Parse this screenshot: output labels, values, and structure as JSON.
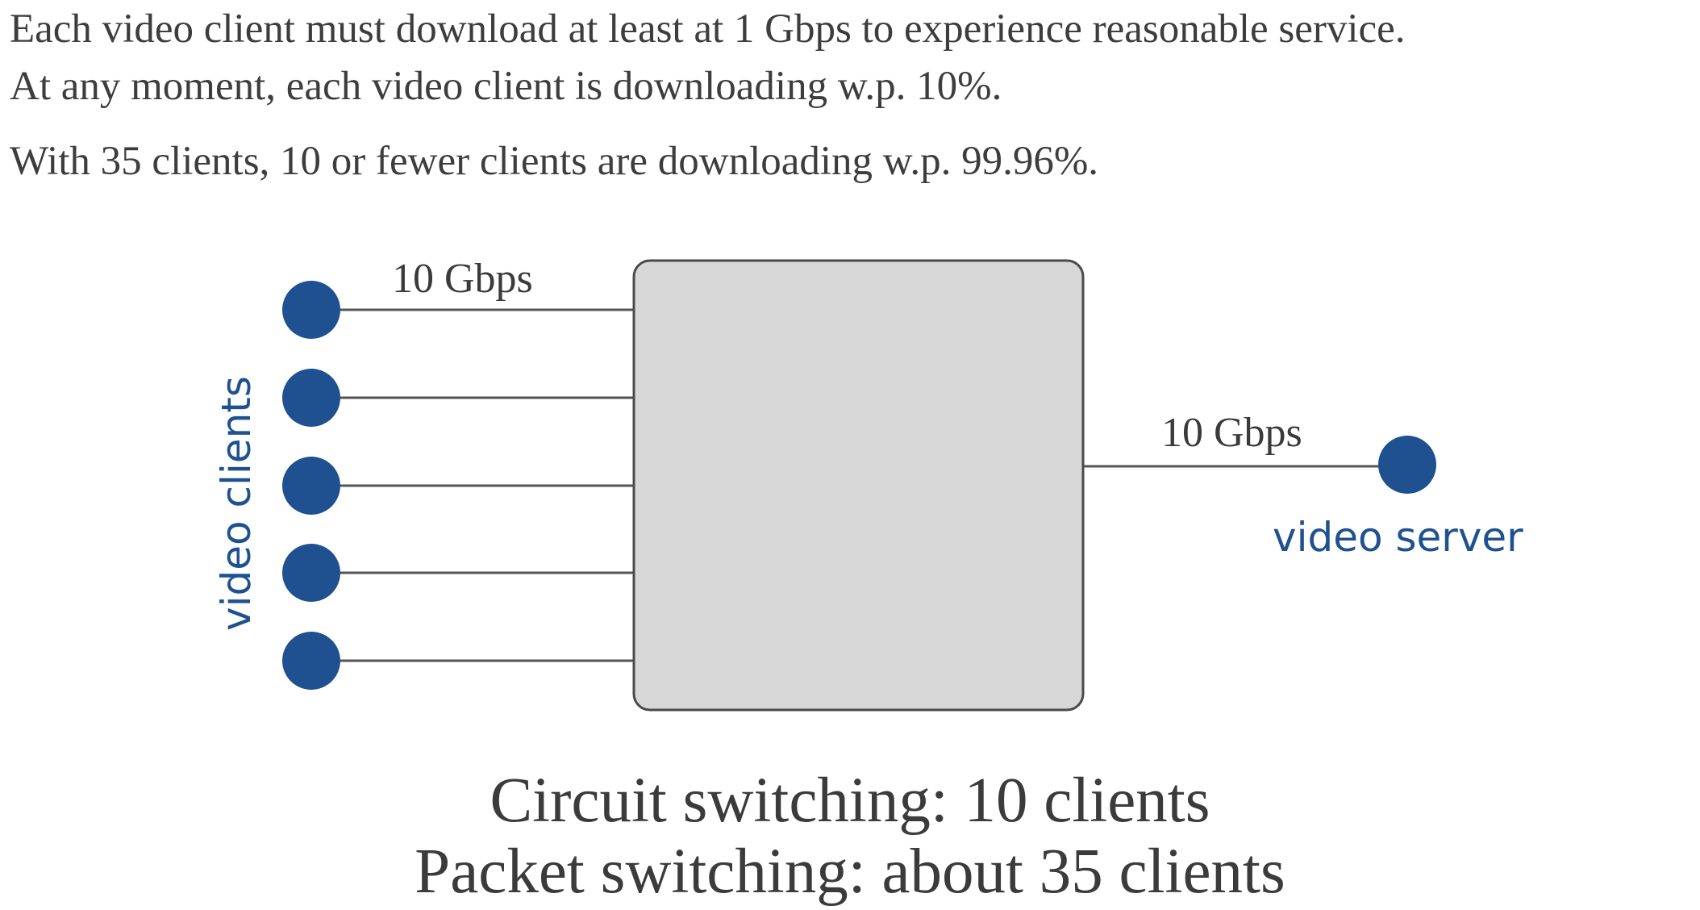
{
  "intro": {
    "line1": "Each video client must download at least at 1 Gbps to experience reasonable service.",
    "line2": "At any moment, each video client is downloading w.p. 10%.",
    "line3": "With 35 clients, 10 or fewer clients are downloading w.p. 99.96%."
  },
  "diagram": {
    "client_link_label": "10 Gbps",
    "server_link_label": "10 Gbps",
    "clients_label": "video clients",
    "server_label": "video server",
    "client_count": 5,
    "colors": {
      "node": "#1f5190",
      "label_blue": "#1f5190",
      "switch_fill": "#d7d7d7",
      "switch_stroke": "#4a4a4a",
      "link": "#555555"
    }
  },
  "caption": {
    "line1": "Circuit switching: 10 clients",
    "line2": "Packet switching: about 35 clients"
  }
}
